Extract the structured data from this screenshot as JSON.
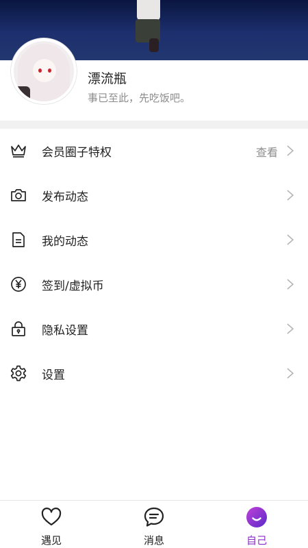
{
  "profile": {
    "name": "漂流瓶",
    "bio": "事已至此，先吃饭吧。"
  },
  "menu": [
    {
      "label": "会员圈子特权",
      "icon": "crown-icon",
      "extra": "查看"
    },
    {
      "label": "发布动态",
      "icon": "camera-icon",
      "extra": ""
    },
    {
      "label": "我的动态",
      "icon": "document-icon",
      "extra": ""
    },
    {
      "label": "签到/虚拟币",
      "icon": "yen-coin-icon",
      "extra": ""
    },
    {
      "label": "隐私设置",
      "icon": "lock-icon",
      "extra": ""
    },
    {
      "label": "设置",
      "icon": "gear-icon",
      "extra": ""
    }
  ],
  "nav": [
    {
      "label": "遇见",
      "icon": "heart-icon",
      "active": false
    },
    {
      "label": "消息",
      "icon": "chat-bubble-icon",
      "active": false
    },
    {
      "label": "自己",
      "icon": "smile-face-icon",
      "active": true
    }
  ],
  "colors": {
    "accent": "#8a2bc9",
    "accent_gradient_start": "#b43fd6",
    "accent_gradient_end": "#5a2bc9",
    "divider": "#f1f1f1",
    "secondary_text": "#8c8c8c"
  }
}
